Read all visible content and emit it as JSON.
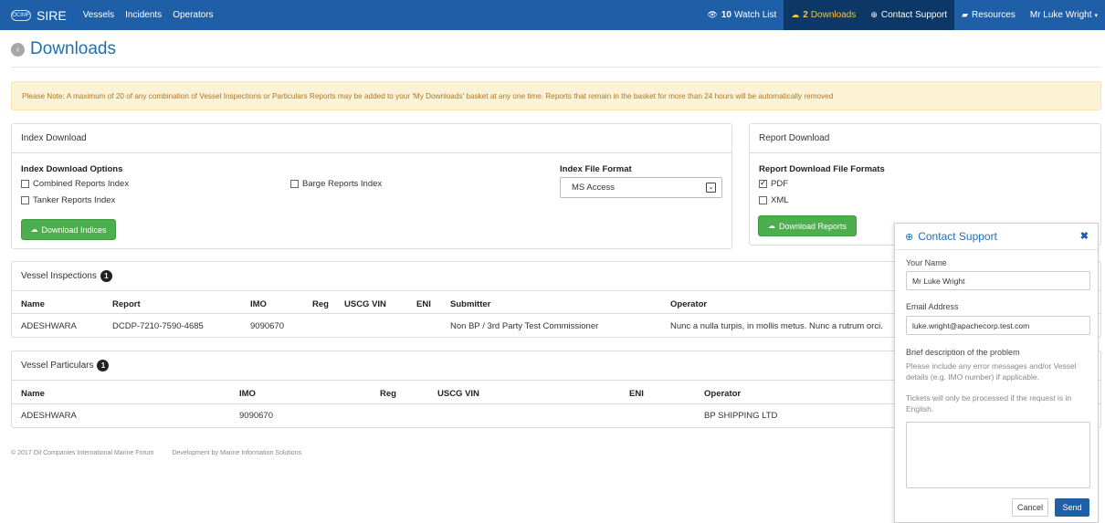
{
  "nav": {
    "brand_logo": "OCIMF",
    "brand": "SIRE",
    "links": [
      "Vessels",
      "Incidents",
      "Operators"
    ],
    "watch_list_count": "10",
    "watch_list_label": "Watch List",
    "downloads_count": "2",
    "downloads_label": "Downloads",
    "contact_support": "Contact Support",
    "resources": "Resources",
    "user": "Mr Luke Wright"
  },
  "page": {
    "title": "Downloads",
    "notice": "Please Note: A maximum of 20 of any combination of Vessel Inspections or Particulars Reports may be added to your 'My Downloads' basket at any one time. Reports that remain in the basket for more than 24 hours will be automatically removed"
  },
  "index_download": {
    "heading": "Index Download",
    "options_label": "Index Download Options",
    "options": [
      {
        "label": "Combined Reports Index",
        "checked": false
      },
      {
        "label": "Tanker Reports Index",
        "checked": false
      },
      {
        "label": "Barge Reports Index",
        "checked": false
      }
    ],
    "format_label": "Index File Format",
    "format_value": "MS Access",
    "button": "Download Indices"
  },
  "report_download": {
    "heading": "Report Download",
    "formats_label": "Report Download File Formats",
    "formats": [
      {
        "label": "PDF",
        "checked": true
      },
      {
        "label": "XML",
        "checked": false
      }
    ],
    "button": "Download Reports"
  },
  "vessel_inspections": {
    "heading": "Vessel Inspections",
    "count": "1",
    "columns": [
      "Name",
      "Report",
      "IMO",
      "Reg",
      "USCG VIN",
      "ENI",
      "Submitter",
      "Operator"
    ],
    "rows": [
      [
        "ADESHWARA",
        "DCDP-7210-7590-4685",
        "9090670",
        "",
        "",
        "",
        "Non BP / 3rd Party Test Commissioner",
        "Nunc a nulla turpis, in mollis metus. Nunc a rutrum orci."
      ]
    ]
  },
  "vessel_particulars": {
    "heading": "Vessel Particulars",
    "count": "1",
    "columns": [
      "Name",
      "IMO",
      "Reg",
      "USCG VIN",
      "ENI",
      "Operator"
    ],
    "rows": [
      [
        "ADESHWARA",
        "9090670",
        "",
        "",
        "",
        "BP SHIPPING LTD"
      ]
    ]
  },
  "footer": {
    "copyright": "© 2017 Oil Companies International Marine Forum",
    "dev": "Development by Marine Information Solutions"
  },
  "contact_support": {
    "title": "Contact Support",
    "name_label": "Your Name",
    "name_value": "Mr Luke Wright",
    "email_label": "Email Address",
    "email_value": "luke.wright@apachecorp.test.com",
    "desc_label": "Brief description of the problem",
    "help1": "Please include any error messages and/or Vessel details (e.g. IMO number) if applicable.",
    "help2": "Tickets will only be processed if the request is in English.",
    "cancel": "Cancel",
    "send": "Send"
  }
}
